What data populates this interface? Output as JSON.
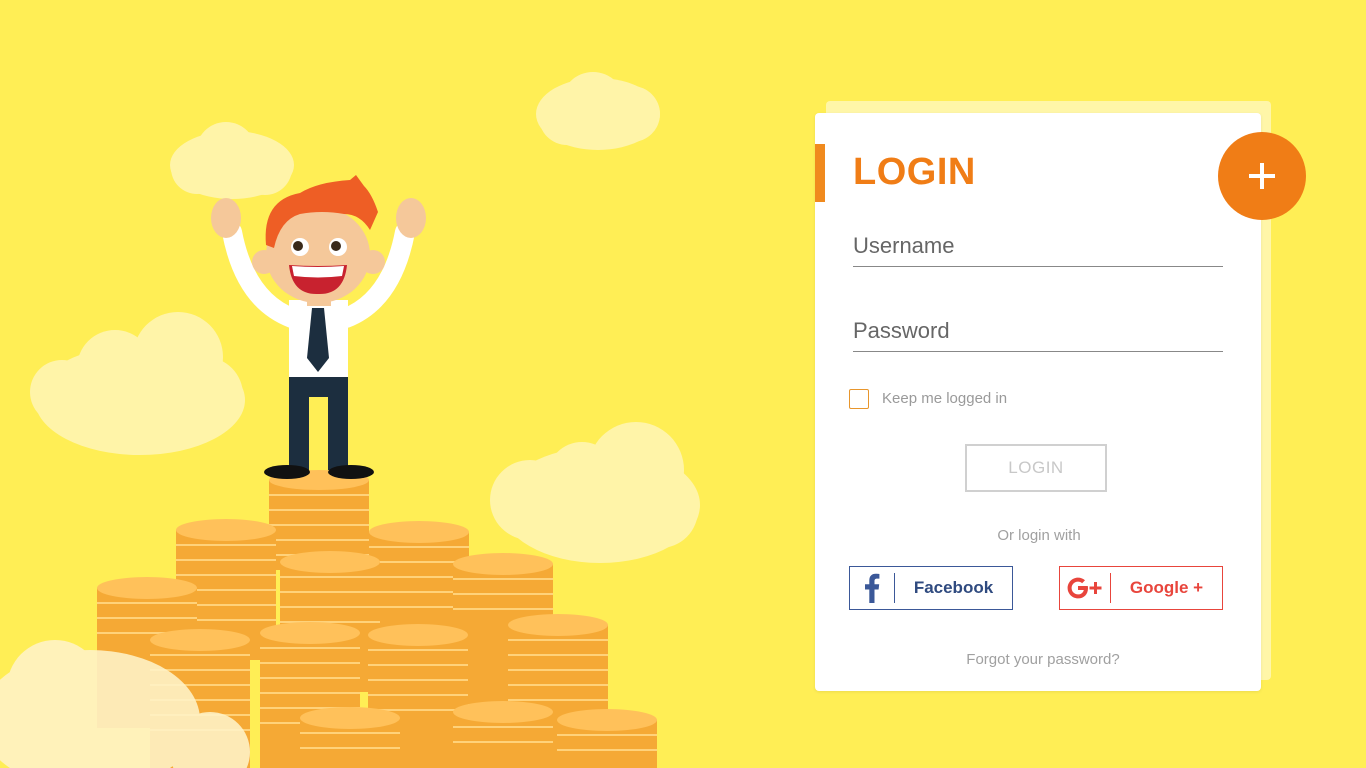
{
  "login": {
    "title": "LOGIN",
    "username_placeholder": "Username",
    "password_placeholder": "Password",
    "keep_logged_in_label": "Keep me logged in",
    "login_button_label": "LOGIN",
    "or_login_with": "Or login with",
    "facebook_label": "Facebook",
    "google_label": "Google +",
    "forgot_password": "Forgot your password?"
  },
  "icons": {
    "plus": "plus-icon",
    "facebook": "facebook-icon",
    "google": "google-plus-icon"
  },
  "colors": {
    "background": "#FFEE55",
    "accent_orange": "#F07D16",
    "facebook_blue": "#3B5898",
    "google_red": "#E8453C"
  }
}
